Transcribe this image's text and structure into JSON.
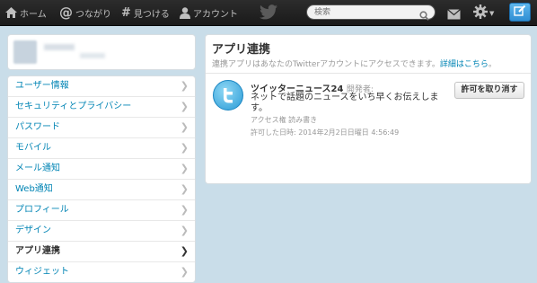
{
  "topbar": {
    "home_label": "ホーム",
    "connect_label": "つながり",
    "discover_label": "見つける",
    "account_label": "アカウント",
    "search_placeholder": "検索",
    "accent_color": "#2f8fd4"
  },
  "sidebar": {
    "items": [
      {
        "label": "ユーザー情報",
        "active": false
      },
      {
        "label": "セキュリティとプライバシー",
        "active": false
      },
      {
        "label": "パスワード",
        "active": false
      },
      {
        "label": "モバイル",
        "active": false
      },
      {
        "label": "メール通知",
        "active": false
      },
      {
        "label": "Web通知",
        "active": false
      },
      {
        "label": "プロフィール",
        "active": false
      },
      {
        "label": "デザイン",
        "active": false
      },
      {
        "label": "アプリ連携",
        "active": true
      },
      {
        "label": "ウィジェット",
        "active": false
      }
    ]
  },
  "main": {
    "title": "アプリ連携",
    "subtitle": "連携アプリはあなたのTwitterアカウントにアクセスできます。",
    "subtitle_link": "詳細はこちら",
    "subtitle_end": "。",
    "app": {
      "name": "ツイッターニュース24",
      "developer_label": "開発者:",
      "description": "ネットで話題のニュースをいち早くお伝えします。",
      "permission": "アクセス権 読み書き",
      "authorized": "許可した日時: 2014年2月2日日曜日 4:56:49",
      "revoke_label": "許可を取り消す"
    }
  }
}
